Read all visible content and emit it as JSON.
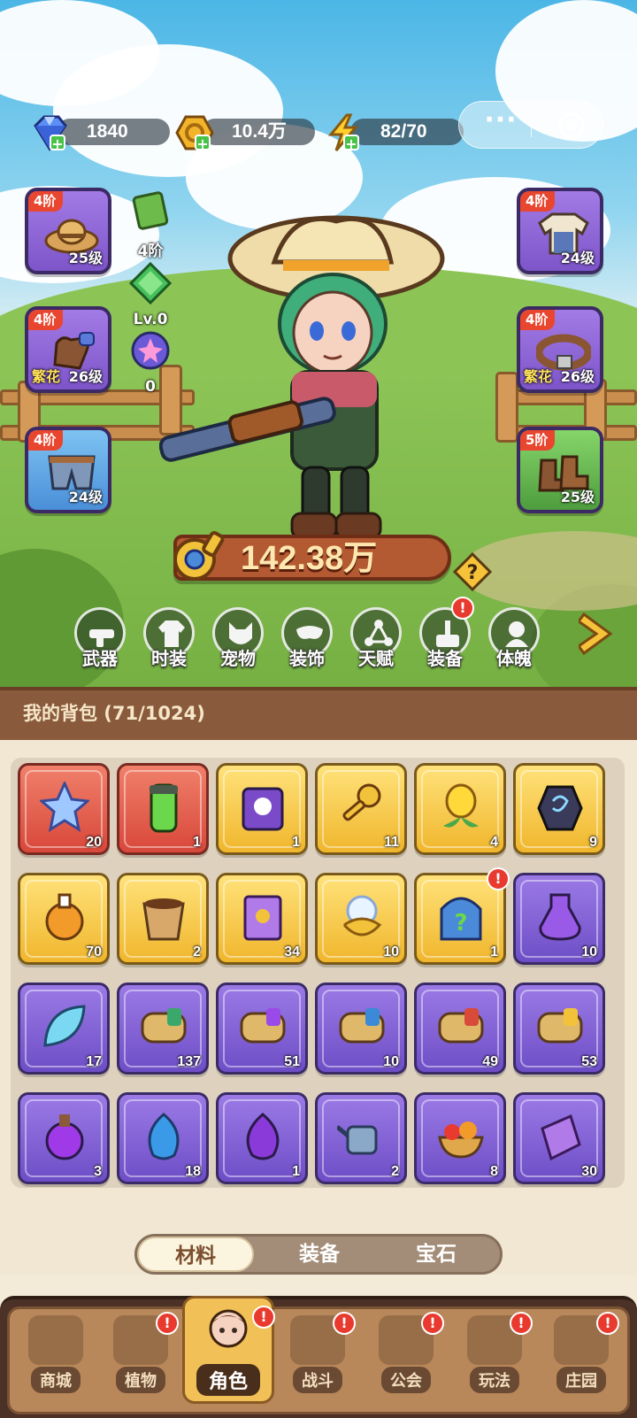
{
  "resources": {
    "diamond": "1840",
    "gold": "10.4万",
    "energy": "82/70"
  },
  "capsule": {
    "more": "···"
  },
  "left_slots": [
    {
      "tier": "4阶",
      "level": "25级",
      "tag": "",
      "icon": "straw-hat-icon",
      "color": "purple"
    },
    {
      "tier": "4阶",
      "level": "26级",
      "tag": "繁花",
      "icon": "glove-icon",
      "color": "purple"
    },
    {
      "tier": "4阶",
      "level": "24级",
      "tag": "",
      "icon": "shorts-icon",
      "color": "blue"
    }
  ],
  "right_slots": [
    {
      "tier": "4阶",
      "level": "24级",
      "tag": "",
      "icon": "shirt-icon",
      "color": "purple"
    },
    {
      "tier": "4阶",
      "level": "26级",
      "tag": "繁花",
      "icon": "belt-icon",
      "color": "purple"
    },
    {
      "tier": "5阶",
      "level": "25级",
      "tag": "",
      "icon": "boots-icon",
      "color": "green"
    }
  ],
  "mini_stats": [
    {
      "label": "4阶",
      "icon": "green-card-icon"
    },
    {
      "label": "Lv.0",
      "icon": "green-gem-icon"
    },
    {
      "label": "0",
      "icon": "star-orb-icon"
    }
  ],
  "power": "142.38万",
  "functions": [
    {
      "label": "武器",
      "icon": "weapon-icon",
      "alert": false
    },
    {
      "label": "时装",
      "icon": "costume-icon",
      "alert": false
    },
    {
      "label": "宠物",
      "icon": "pet-icon",
      "alert": false
    },
    {
      "label": "装饰",
      "icon": "mask-icon",
      "alert": false
    },
    {
      "label": "天赋",
      "icon": "talent-icon",
      "alert": false
    },
    {
      "label": "装备",
      "icon": "equipment-icon",
      "alert": true
    },
    {
      "label": "体魄",
      "icon": "physique-icon",
      "alert": false
    }
  ],
  "bag": {
    "title": "我的背包 (71/1024)"
  },
  "items": [
    {
      "count": "20",
      "color": "red",
      "icon": "crystal-star-icon",
      "alert": false
    },
    {
      "count": "1",
      "color": "red",
      "icon": "green-tube-icon",
      "alert": false
    },
    {
      "count": "1",
      "color": "gold",
      "icon": "skull-scroll-icon",
      "alert": false
    },
    {
      "count": "11",
      "color": "gold",
      "icon": "golden-key-icon",
      "alert": false
    },
    {
      "count": "4",
      "color": "gold",
      "icon": "golden-flower-icon",
      "alert": false
    },
    {
      "count": "9",
      "color": "gold",
      "icon": "rune-stone-icon",
      "alert": false
    },
    {
      "count": "70",
      "color": "gold",
      "icon": "orange-potion-icon",
      "alert": false
    },
    {
      "count": "2",
      "color": "gold",
      "icon": "soil-pot-icon",
      "alert": false
    },
    {
      "count": "34",
      "color": "gold",
      "icon": "spell-book-icon",
      "alert": false
    },
    {
      "count": "10",
      "color": "gold",
      "icon": "glow-flower-icon",
      "alert": false
    },
    {
      "count": "1",
      "color": "gold",
      "icon": "mystery-box-icon",
      "alert": true
    },
    {
      "count": "10",
      "color": "purple",
      "icon": "purple-potion-icon",
      "alert": false
    },
    {
      "count": "17",
      "color": "purple",
      "icon": "blue-leaf-icon",
      "alert": false
    },
    {
      "count": "137",
      "color": "purple",
      "icon": "scroll-green-icon",
      "alert": false
    },
    {
      "count": "51",
      "color": "purple",
      "icon": "scroll-purple-icon",
      "alert": false
    },
    {
      "count": "10",
      "color": "purple",
      "icon": "scroll-blue-icon",
      "alert": false
    },
    {
      "count": "49",
      "color": "purple",
      "icon": "scroll-red-icon",
      "alert": false
    },
    {
      "count": "53",
      "color": "purple",
      "icon": "scroll-gold-icon",
      "alert": false
    },
    {
      "count": "3",
      "color": "purple",
      "icon": "violet-potion-icon",
      "alert": false
    },
    {
      "count": "18",
      "color": "purple",
      "icon": "blue-bud-icon",
      "alert": false
    },
    {
      "count": "1",
      "color": "purple",
      "icon": "purple-bulb-icon",
      "alert": false
    },
    {
      "count": "2",
      "color": "purple",
      "icon": "watering-can-icon",
      "alert": false
    },
    {
      "count": "8",
      "color": "purple",
      "icon": "fruit-bowl-icon",
      "alert": false
    },
    {
      "count": "30",
      "color": "purple",
      "icon": "purple-crystal-icon",
      "alert": false
    }
  ],
  "tabs": [
    {
      "label": "材料",
      "active": true
    },
    {
      "label": "装备",
      "active": false
    },
    {
      "label": "宝石",
      "active": false
    }
  ],
  "nav": [
    {
      "label": "商城",
      "icon": "shop-icon",
      "alert": false,
      "active": false
    },
    {
      "label": "植物",
      "icon": "plant-icon",
      "alert": true,
      "active": false
    },
    {
      "label": "角色",
      "icon": "character-icon",
      "alert": true,
      "active": true
    },
    {
      "label": "战斗",
      "icon": "battle-icon",
      "alert": true,
      "active": false
    },
    {
      "label": "公会",
      "icon": "guild-icon",
      "alert": true,
      "active": false
    },
    {
      "label": "玩法",
      "icon": "gameplay-icon",
      "alert": true,
      "active": false
    },
    {
      "label": "庄园",
      "icon": "manor-icon",
      "alert": true,
      "active": false
    }
  ],
  "colors": {
    "alert": "#e83a2e",
    "purple": "#7d55c9",
    "gold": "#f0b62c",
    "red": "#d8473a"
  }
}
